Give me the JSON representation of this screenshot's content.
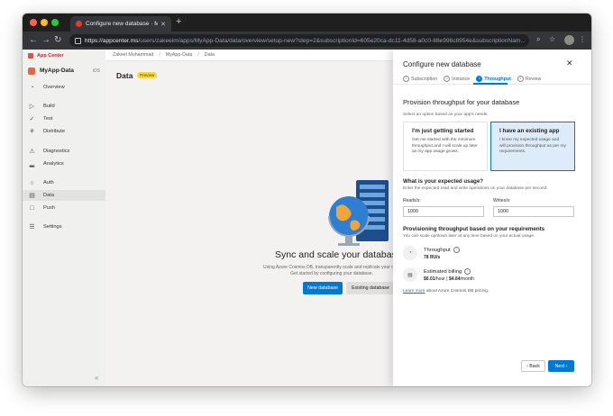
{
  "browser": {
    "tab_title": "Configure new database · MyA…",
    "url_host": "https://appcenter.ms",
    "url_path": "/users/zakeeim/apps/MyApp-Data/data/overview/setup-new?step=2&subscriptionId=605e20ca-dc11-4d58-a0c0-88e996c8954e&subscriptionNam..."
  },
  "sidebar": {
    "brand": "App Center",
    "app_name": "MyApp-Data",
    "app_platform": "iOS",
    "items": [
      {
        "label": "Overview",
        "icon": "overview-icon",
        "glyph": "◔"
      },
      {
        "label": "Build",
        "icon": "play-icon",
        "glyph": "▷"
      },
      {
        "label": "Test",
        "icon": "check-circle-icon",
        "glyph": "✓"
      },
      {
        "label": "Distribute",
        "icon": "distribute-icon",
        "glyph": "⚘"
      },
      {
        "label": "Diagnostics",
        "icon": "warning-icon",
        "glyph": "⚠"
      },
      {
        "label": "Analytics",
        "icon": "bar-chart-icon",
        "glyph": "▂"
      },
      {
        "label": "Auth",
        "icon": "user-icon",
        "glyph": "○"
      },
      {
        "label": "Data",
        "icon": "database-icon",
        "glyph": "▤"
      },
      {
        "label": "Push",
        "icon": "push-icon",
        "glyph": "□"
      },
      {
        "label": "Settings",
        "icon": "settings-icon",
        "glyph": "☰"
      }
    ],
    "active_item": "Data"
  },
  "breadcrumb": [
    "Zakeel Muhammad",
    "MyApp-Data",
    "Data"
  ],
  "main": {
    "title": "Data",
    "badge": "Preview",
    "hero_title": "Sync and scale your database g",
    "hero_desc_1": "Using Azure Cosmos DB, transparently scale and replicate your data",
    "hero_desc_2": "Get started by configuring your database.",
    "new_db_button": "New database",
    "existing_db_button": "Existing database"
  },
  "panel": {
    "title": "Configure new database",
    "steps": [
      {
        "num": "1",
        "label": "Subscription"
      },
      {
        "num": "2",
        "label": "Instance"
      },
      {
        "num": "3",
        "label": "Throughput"
      },
      {
        "num": "4",
        "label": "Review"
      }
    ],
    "active_step": "Throughput",
    "heading": "Provision throughput for your database",
    "subheading": "Select an option based on your app's needs.",
    "option_cards": [
      {
        "title": "I'm just getting started",
        "desc": "Get me started with the minimum throughput and I will scale up later as my app usage grows."
      },
      {
        "title": "I have an existing app",
        "desc": "I know my expected usage and will provision throughput as per my requirements."
      }
    ],
    "selected_option": "I have an existing app",
    "usage_title": "What is your expected usage?",
    "usage_desc": "Enter the expected read and write operations on your database per second.",
    "reads_label": "Reads/s:",
    "reads_value": "1000",
    "writes_label": "Writes/s:",
    "writes_value": "1000",
    "prov_title": "Provisioning throughput based on your requirements",
    "prov_desc": "You can scale up/down later at any time based on your actual usage.",
    "throughput_label": "Throughput",
    "throughput_value": "78 RU/s",
    "billing_label": "Estimated billing",
    "billing_hour": "$0.01",
    "billing_hour_unit": "/hour |",
    "billing_month": "$4.64",
    "billing_month_unit": "/month",
    "learn_link": "Learn more",
    "learn_text": " about Azure Cosmos DB pricing.",
    "back_button": "‹  Back",
    "next_button": "Next  ›"
  },
  "colors": {
    "accent": "#0078d4",
    "brand": "#c1272d",
    "badge": "#f5d547",
    "selected_card_bg": "#deecf9"
  }
}
